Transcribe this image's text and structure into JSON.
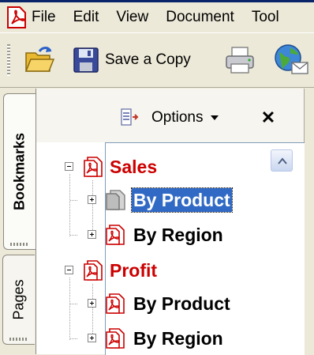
{
  "menubar": {
    "items": [
      "File",
      "Edit",
      "View",
      "Document",
      "Tool"
    ]
  },
  "toolbar": {
    "save_copy_label": "Save a Copy"
  },
  "side_tabs": {
    "bookmarks": "Bookmarks",
    "pages": "Pages"
  },
  "bookmarks_panel": {
    "options_label": "Options",
    "close_label": "✕"
  },
  "tree": {
    "nodes": [
      {
        "label": "Sales",
        "level": 0,
        "expanded": true,
        "color": "#cc0000"
      },
      {
        "label": "By Product",
        "level": 1,
        "expanded": false,
        "selected": true
      },
      {
        "label": "By Region",
        "level": 1,
        "expanded": false
      },
      {
        "label": "Profit",
        "level": 0,
        "expanded": true,
        "color": "#cc0000"
      },
      {
        "label": "By Product",
        "level": 1,
        "expanded": false
      },
      {
        "label": "By Region",
        "level": 1,
        "expanded": false
      }
    ]
  },
  "colors": {
    "selection": "#316ac5",
    "top_level_bookmark": "#cc0000",
    "chrome": "#ece9d8"
  }
}
